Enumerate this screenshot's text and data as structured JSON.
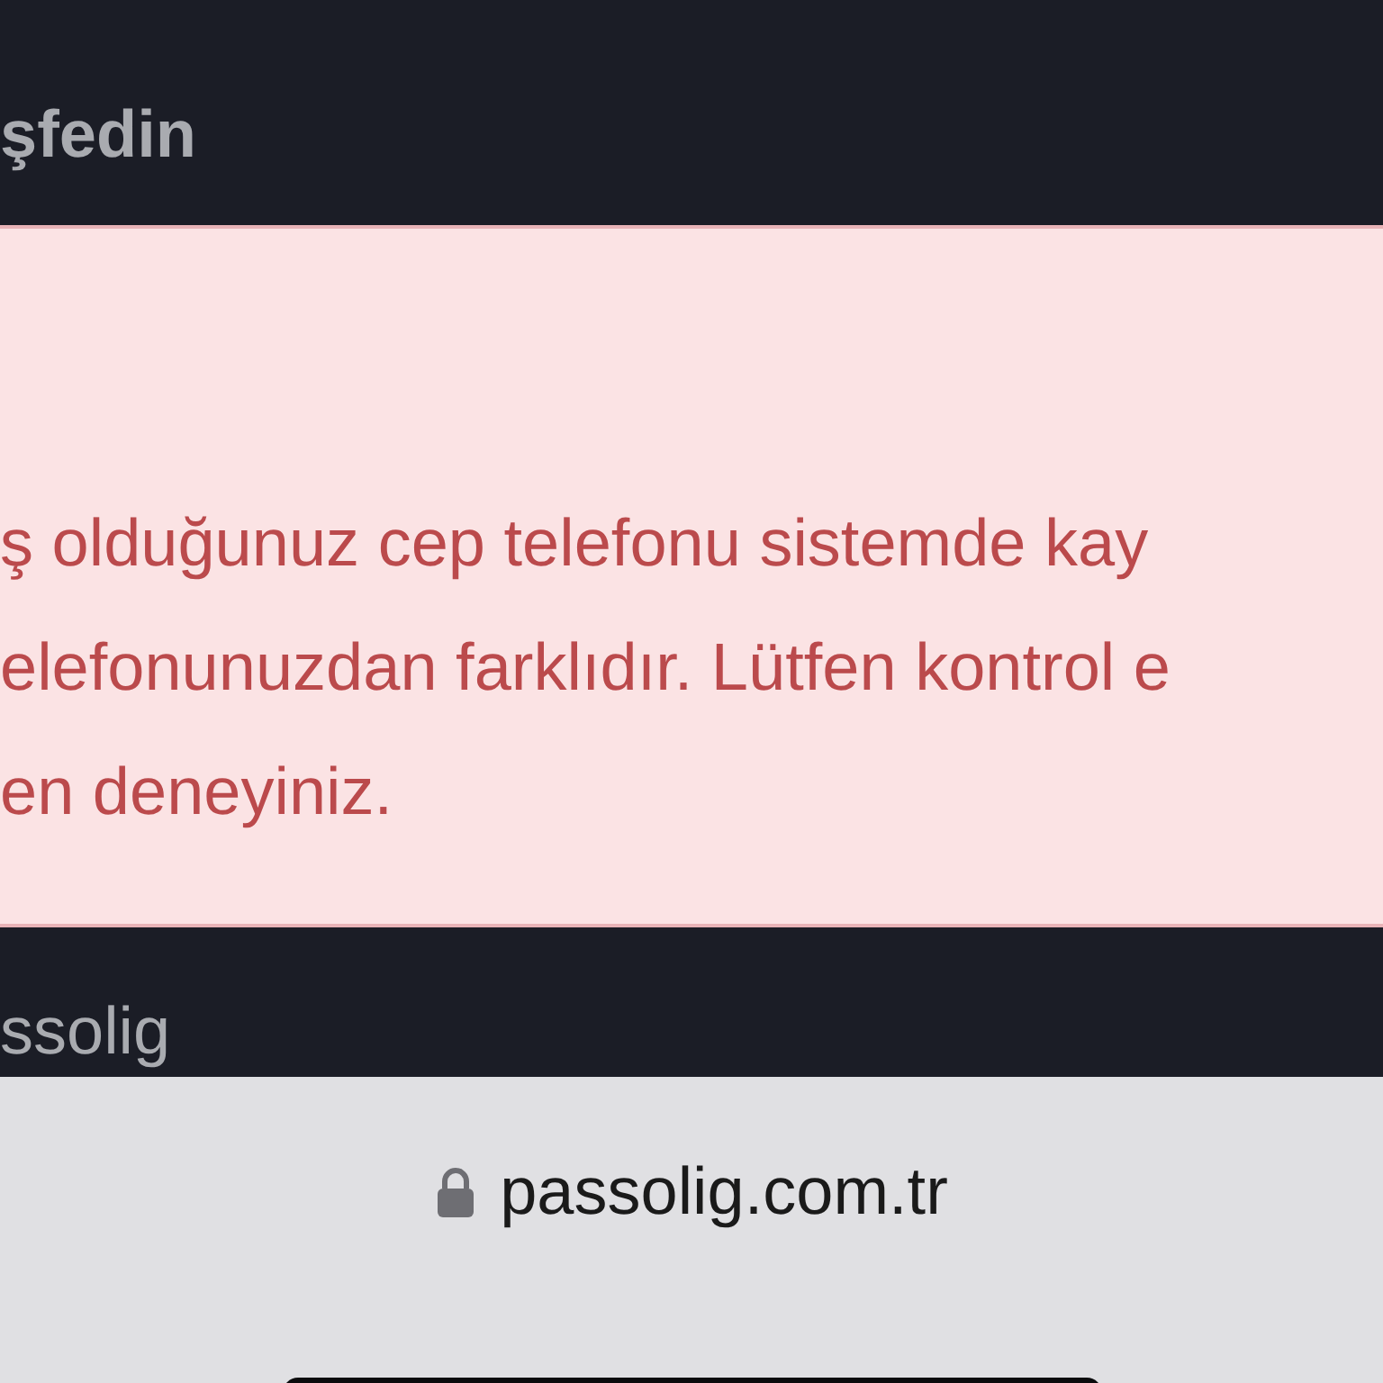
{
  "page_heading": "şfedin",
  "alert": {
    "lines": [
      "ş olduğunuz cep telefonu sistemde kay",
      "elefonunuzdan farklıdır. Lütfen kontrol e",
      "en deneyiniz."
    ]
  },
  "menu_item": "ssolig",
  "browser_bar": {
    "url": "passolig.com.tr",
    "secure": true
  }
}
